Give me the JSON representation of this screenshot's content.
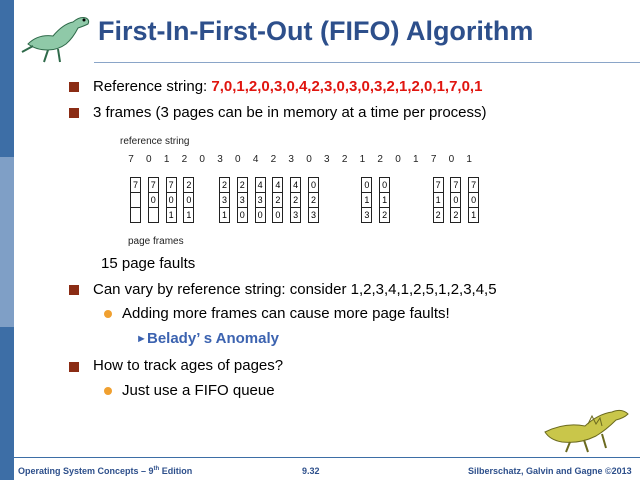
{
  "slide": {
    "title": "First-In-First-Out (FIFO) Algorithm",
    "bullets": {
      "ref_prefix": "Reference string: ",
      "ref_values": "7,0,1,2,0,3,0,4,2,3,0,3,0,3,2,1,2,0,1,7,0,1",
      "frames": "3 frames (3 pages can be in memory at a time per process)",
      "page_faults": "15 page faults",
      "vary": "Can vary by reference string: consider 1,2,3,4,1,2,5,1,2,3,4,5",
      "adding": "Adding more frames can cause more page faults!",
      "belady": "Belady’ s Anomaly",
      "track": "How to track ages of pages?",
      "fifo_queue": "Just use a FIFO queue"
    }
  },
  "diagram": {
    "reference_label": "reference string",
    "reference_numbers": [
      "7",
      "0",
      "1",
      "2",
      "0",
      "3",
      "0",
      "4",
      "2",
      "3",
      "0",
      "3",
      "2",
      "1",
      "2",
      "0",
      "1",
      "7",
      "0",
      "1"
    ],
    "page_frames_label": "page frames",
    "columns": [
      [
        "7",
        "",
        ""
      ],
      [
        "7",
        "0",
        ""
      ],
      [
        "7",
        "0",
        "1"
      ],
      [
        "2",
        "0",
        "1"
      ],
      [
        "2",
        "3",
        "1"
      ],
      [
        "2",
        "3",
        "0"
      ],
      [
        "4",
        "3",
        "0"
      ],
      [
        "4",
        "2",
        "0"
      ],
      [
        "4",
        "2",
        "3"
      ],
      [
        "0",
        "2",
        "3"
      ],
      [
        "0",
        "1",
        "3"
      ],
      [
        "0",
        "1",
        "2"
      ],
      [
        "7",
        "1",
        "2"
      ],
      [
        "7",
        "0",
        "2"
      ],
      [
        "7",
        "0",
        "1"
      ]
    ]
  },
  "footer": {
    "left_prefix": "Operating System Concepts – 9",
    "left_sup": "th",
    "left_suffix": " Edition",
    "page": "9.32",
    "right": "Silberschatz, Galvin and Gagne ©2013"
  }
}
